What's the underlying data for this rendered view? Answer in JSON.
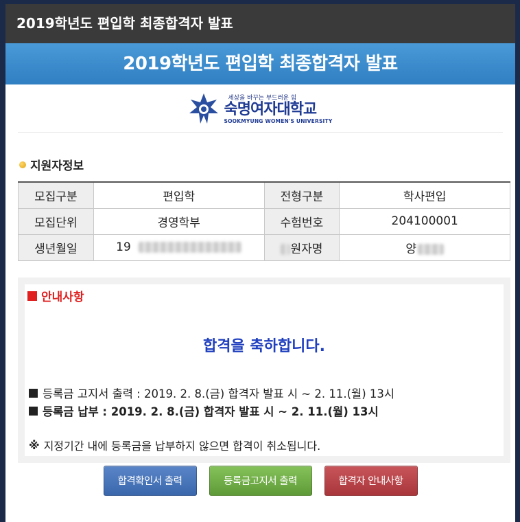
{
  "window": {
    "title": "2019학년도 편입학 최종합격자 발표"
  },
  "banner": {
    "title": "2019학년도 편입학 최종합격자 발표"
  },
  "logo": {
    "tagline": "세상을 바꾸는 부드러운 힘",
    "name": "숙명여자대학교",
    "english": "SOOKMYUNG WOMEN'S UNIVERSITY"
  },
  "applicant": {
    "section_title": "지원자정보",
    "rows": [
      {
        "h1": "모집구분",
        "v1": "편입학",
        "h2": "전형구분",
        "v2": "학사편입"
      },
      {
        "h1": "모집단위",
        "v1": "경영학부",
        "h2": "수험번호",
        "v2": "204100001"
      },
      {
        "h1": "생년월일",
        "v1": "19",
        "h2": "원자명",
        "v2": "양"
      }
    ]
  },
  "notice": {
    "title": "안내사항",
    "congrats": "합격을 축하합니다.",
    "line1": "등록금 고지서 출력 : 2019. 2. 8.(금) 합격자 발표 시 ~ 2. 11.(월) 13시",
    "line2": "등록금 납부 : 2019. 2. 8.(금) 합격자 발표 시 ~ 2. 11.(월) 13시",
    "line3_mark": "※",
    "line3": "지정기간 내에 등록금을 납부하지 않으면 합격이 취소됩니다."
  },
  "buttons": {
    "confirm": "합격확인서 출력",
    "invoice": "등록금고지서 출력",
    "guide": "합격자 안내사항"
  },
  "colors": {
    "banner": "#3a8bd0",
    "notice_title": "#e01f1f",
    "congrats": "#1f3fbf",
    "btn_blue": "#4a76bc",
    "btn_green": "#72ae49",
    "btn_red": "#b8454a"
  }
}
